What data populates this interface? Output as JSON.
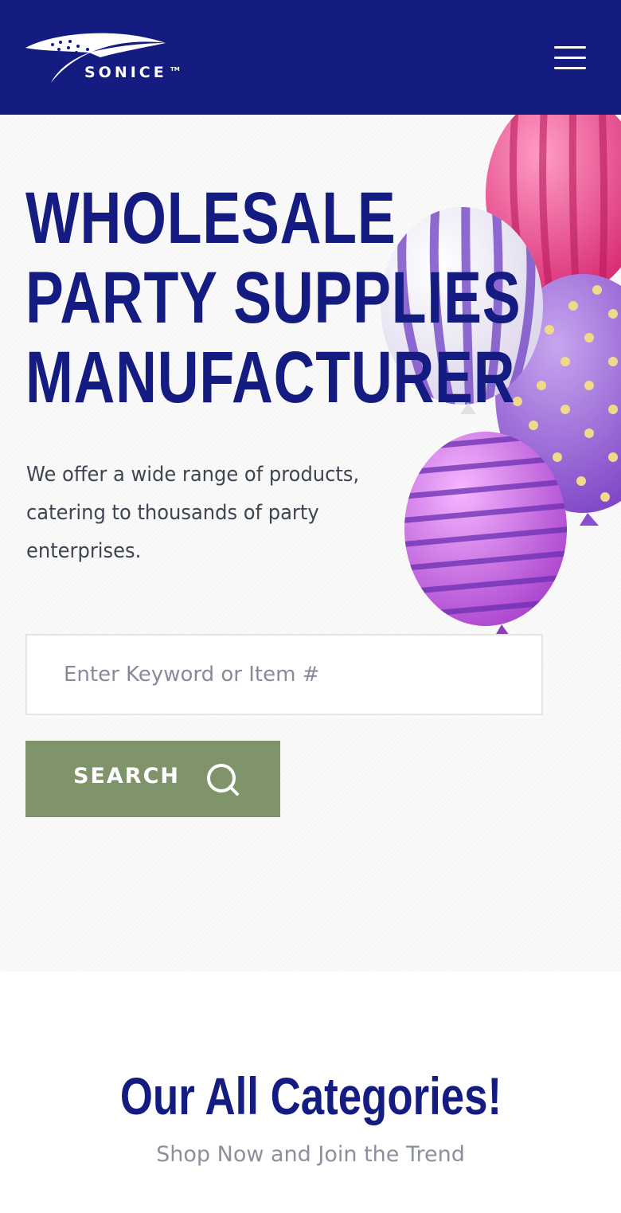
{
  "brand": {
    "name": "SONICE",
    "trademark": "TM",
    "logo_icon": "swoosh-stars-logo"
  },
  "header": {
    "background": "#141c82",
    "menu_icon": "hamburger-menu-icon"
  },
  "hero": {
    "title_lines": [
      "WHOLESALE",
      "PARTY SUPPLIES",
      "MANUFACTURER"
    ],
    "subtitle": "We offer a wide range of products, catering to thousands of party enterprises.",
    "decoration": "party-balloons"
  },
  "search": {
    "placeholder": "Enter Keyword or Item #",
    "value": "",
    "button_label": "SEARCH",
    "button_icon": "search-icon",
    "button_color": "#7f946a"
  },
  "categories": {
    "title": "Our All Categories!",
    "subtitle": "Shop Now and Join the Trend"
  },
  "colors": {
    "primary": "#141c82",
    "accent": "#7f946a",
    "text": "#3e4452",
    "muted": "#8b8f9e"
  }
}
